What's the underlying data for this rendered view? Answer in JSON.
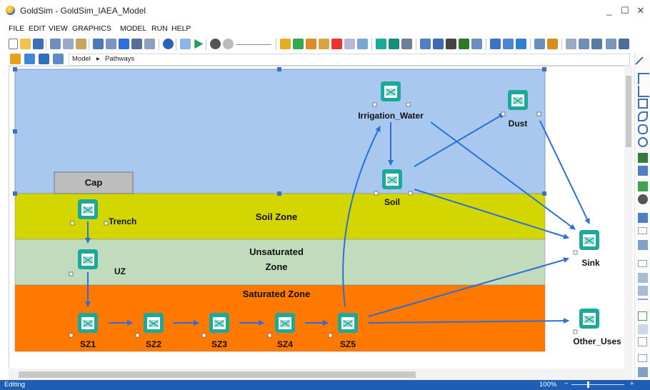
{
  "window": {
    "title": "GoldSim - GoldSim_IAEA_Model",
    "minimize": "_",
    "maximize": "☐",
    "close": "✕"
  },
  "menu": [
    "FILE",
    "EDIT",
    "VIEW",
    "GRAPHICS",
    "MODEL",
    "RUN",
    "HELP"
  ],
  "breadcrumb": {
    "root": "Model",
    "separator": "▸",
    "current": "Pathways"
  },
  "zones": {
    "cap": "Cap",
    "soil": "Soil Zone",
    "unsaturated_1": "Unsaturated",
    "unsaturated_2": "Zone",
    "saturated": "Saturated Zone"
  },
  "nodes": {
    "irrigation_water": "Irrigation_Water",
    "dust": "Dust",
    "soil": "Soil",
    "trench": "Trench",
    "uz": "UZ",
    "sink": "Sink",
    "other_uses": "Other_Uses",
    "sz1": "SZ1",
    "sz2": "SZ2",
    "sz3": "SZ3",
    "sz4": "SZ4",
    "sz5": "SZ5"
  },
  "colors": {
    "sky": "#a8c8ef",
    "soil_zone": "#d4d600",
    "unsaturated_zone": "#c0dcbc",
    "saturated_zone": "#ff7800",
    "node": "#1aa99b",
    "arrow": "#2b6fd8",
    "statusbar": "#1e5fb5"
  },
  "status": {
    "mode": "Editing",
    "zoom": "100%",
    "zoom_minus": "−",
    "zoom_plus": "+"
  }
}
